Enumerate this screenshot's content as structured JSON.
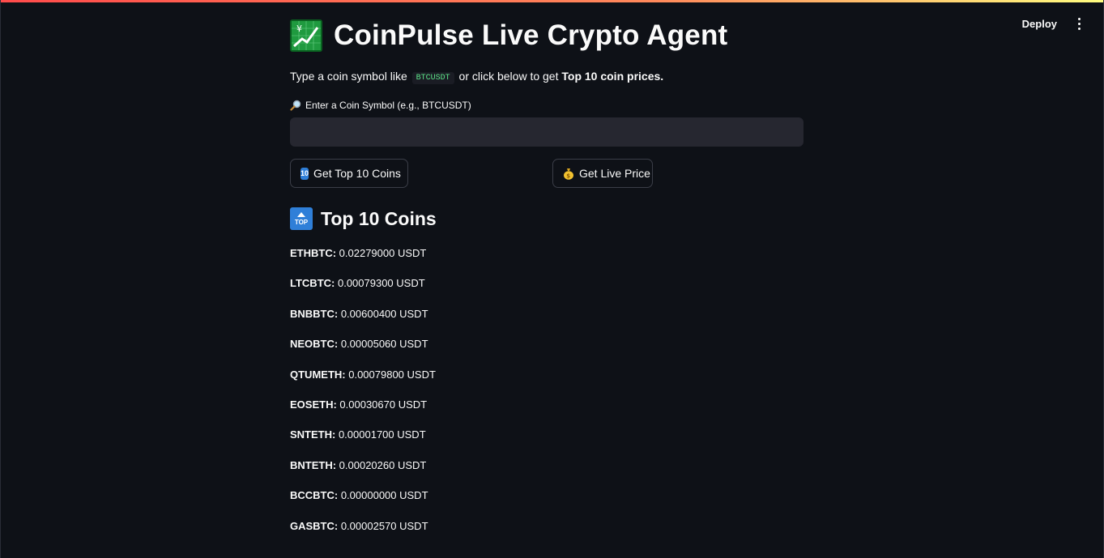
{
  "header": {
    "deploy_label": "Deploy"
  },
  "main": {
    "title": "CoinPulse Live Crypto Agent",
    "intro": {
      "text_before": "Type a coin symbol like",
      "example_symbol": "BTCUSDT",
      "text_middle": "or click below to get",
      "bold_text": "Top 10 coin prices."
    },
    "input": {
      "label": "Enter a Coin Symbol (e.g., BTCUSDT)",
      "value": "",
      "placeholder": ""
    },
    "buttons": {
      "top10_label": "Get Top 10 Coins",
      "top10_icon_text": "10",
      "live_price_label": "Get Live Price"
    },
    "section": {
      "title": "Top 10 Coins",
      "icon_text": "TOP"
    },
    "coins": [
      {
        "symbol": "ETHBTC:",
        "price": " 0.02279000 USDT"
      },
      {
        "symbol": "LTCBTC:",
        "price": " 0.00079300 USDT"
      },
      {
        "symbol": "BNBBTC:",
        "price": " 0.00600400 USDT"
      },
      {
        "symbol": "NEOBTC:",
        "price": " 0.00005060 USDT"
      },
      {
        "symbol": "QTUMETH:",
        "price": " 0.00079800 USDT"
      },
      {
        "symbol": "EOSETH:",
        "price": " 0.00030670 USDT"
      },
      {
        "symbol": "SNTETH:",
        "price": " 0.00001700 USDT"
      },
      {
        "symbol": "BNTETH:",
        "price": " 0.00020260 USDT"
      },
      {
        "symbol": "BCCBTC:",
        "price": " 0.00000000 USDT"
      },
      {
        "symbol": "GASBTC:",
        "price": " 0.00002570 USDT"
      }
    ]
  },
  "icons": {
    "title_icon": "chart-increasing-icon",
    "label_icon": "magnifier-icon",
    "top10_icon": "keycap-ten-icon",
    "live_icon": "money-bag-icon",
    "section_icon": "top-arrow-icon",
    "menu_icon": "kebab-menu-icon"
  },
  "colors": {
    "background": "#0e1117",
    "input_bg": "#262730",
    "code_green": "#5ce488",
    "accent_blue": "#2f7fd8"
  }
}
